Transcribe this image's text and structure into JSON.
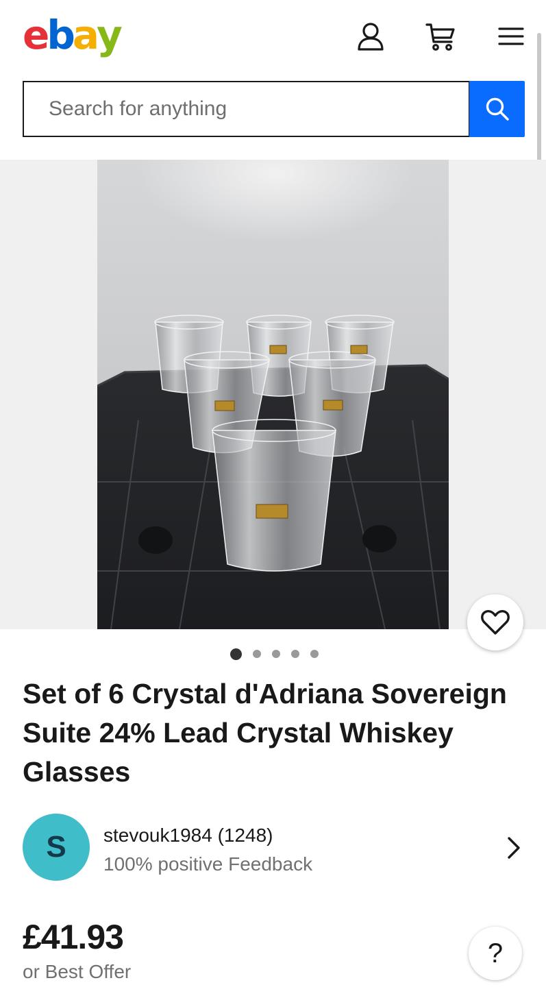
{
  "header": {
    "logo_letters": [
      "e",
      "b",
      "a",
      "y"
    ],
    "logo_colors": [
      "#e53238",
      "#0064d2",
      "#f5af02",
      "#86b817"
    ],
    "icons": [
      "account-icon",
      "cart-icon",
      "menu-icon"
    ]
  },
  "search": {
    "placeholder": "Search for anything",
    "button_icon": "search-icon",
    "accent": "#0a6cff"
  },
  "gallery": {
    "image_count": 5,
    "active_index": 0,
    "favorite_icon": "heart-icon"
  },
  "listing": {
    "title": "Set of 6 Crystal d'Adriana Sovereign Suite 24% Lead Crystal Whiskey Glasses"
  },
  "seller": {
    "avatar_initial": "S",
    "name_and_score": "stevouk1984 (1248)",
    "feedback": "100% positive Feedback"
  },
  "price": {
    "amount": "£41.93",
    "offer_text": "or Best Offer"
  },
  "help": {
    "label": "?"
  }
}
